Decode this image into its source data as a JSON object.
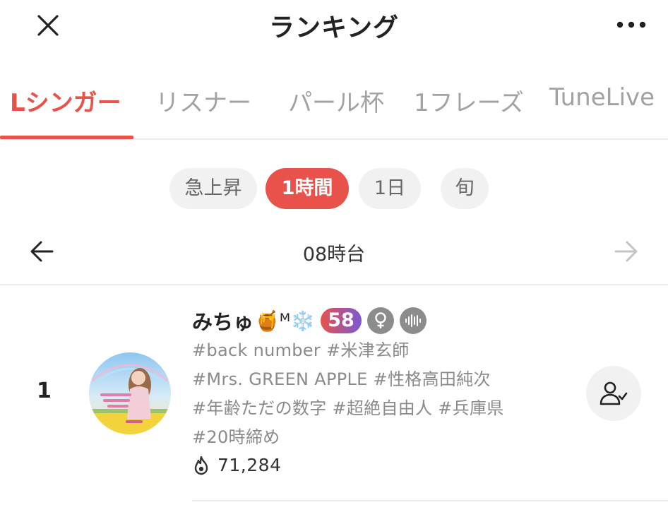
{
  "header": {
    "title": "ランキング",
    "close_icon": "close-icon",
    "more_icon": "more-horizontal-icon"
  },
  "tabs": [
    {
      "label": "Lシンガー",
      "active": true
    },
    {
      "label": "リスナー",
      "active": false
    },
    {
      "label": "パール杯",
      "active": false
    },
    {
      "label": "1フレーズ",
      "active": false
    },
    {
      "label": "TuneLive",
      "active": false
    }
  ],
  "periods": [
    {
      "label": "急上昇",
      "active": false
    },
    {
      "label": "1時間",
      "active": true
    },
    {
      "label": "1日",
      "active": false
    },
    {
      "label": "旬",
      "active": false
    }
  ],
  "hour_nav": {
    "label": "08時台",
    "prev_icon": "arrow-left-icon",
    "next_icon": "arrow-right-icon"
  },
  "ranking": [
    {
      "rank": "1",
      "name": "みちゅ",
      "name_emojis": "🍯ᴹ❄️",
      "level": "58",
      "badges": [
        "female-icon",
        "voice-wave-icon"
      ],
      "tag_lines": [
        "#back number #米津玄師",
        "#Mrs. GREEN APPLE #性格高田純次",
        "#年齢ただの数字 #超絶自由人 #兵庫県",
        "#20時締め"
      ],
      "score_icon": "flame-icon",
      "score": "71,284",
      "follow_icon": "followed-user-icon"
    }
  ],
  "colors": {
    "accent": "#e8524a",
    "level_gradient_end": "#7a58d8",
    "inactive_text": "#a2a2a2",
    "pill_bg": "#f1f1f1"
  }
}
